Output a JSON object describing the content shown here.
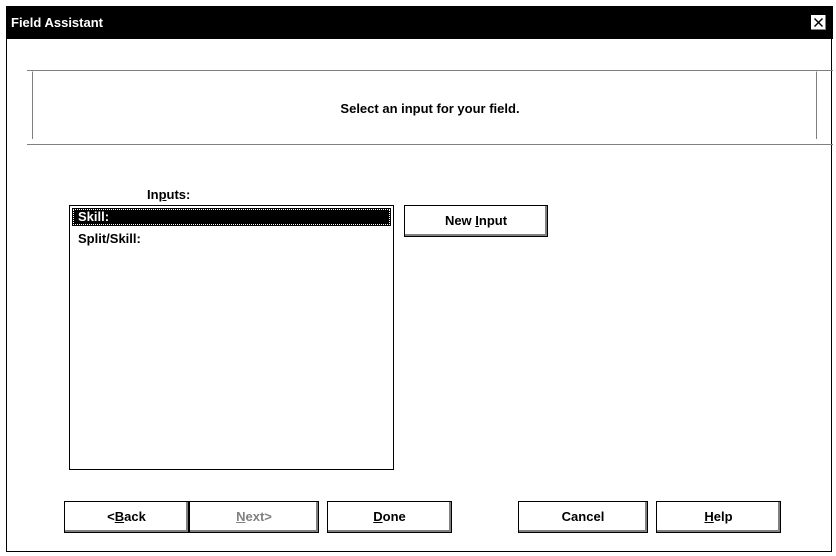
{
  "window": {
    "title": "Field Assistant",
    "close_symbol": "×"
  },
  "header": {
    "instruction": "Select an input for your field."
  },
  "inputs": {
    "label_prefix": "In",
    "label_mnemonic": "p",
    "label_suffix": "uts:",
    "items": [
      {
        "label": "Skill:",
        "selected": true
      },
      {
        "label": "Split/Skill:",
        "selected": false
      }
    ]
  },
  "buttons": {
    "new_input_prefix": "New ",
    "new_input_mnemonic": "I",
    "new_input_suffix": "nput",
    "back_prefix": "<",
    "back_mnemonic": "B",
    "back_suffix": "ack",
    "next_mnemonic": "N",
    "next_suffix": "ext>",
    "done_mnemonic": "D",
    "done_suffix": "one",
    "cancel": "Cancel",
    "help_mnemonic": "H",
    "help_suffix": "elp"
  },
  "colors": {
    "titlebar_bg": "#000000",
    "titlebar_text": "#ffffff",
    "disabled_text": "#808080",
    "selection_bg": "#000000"
  }
}
